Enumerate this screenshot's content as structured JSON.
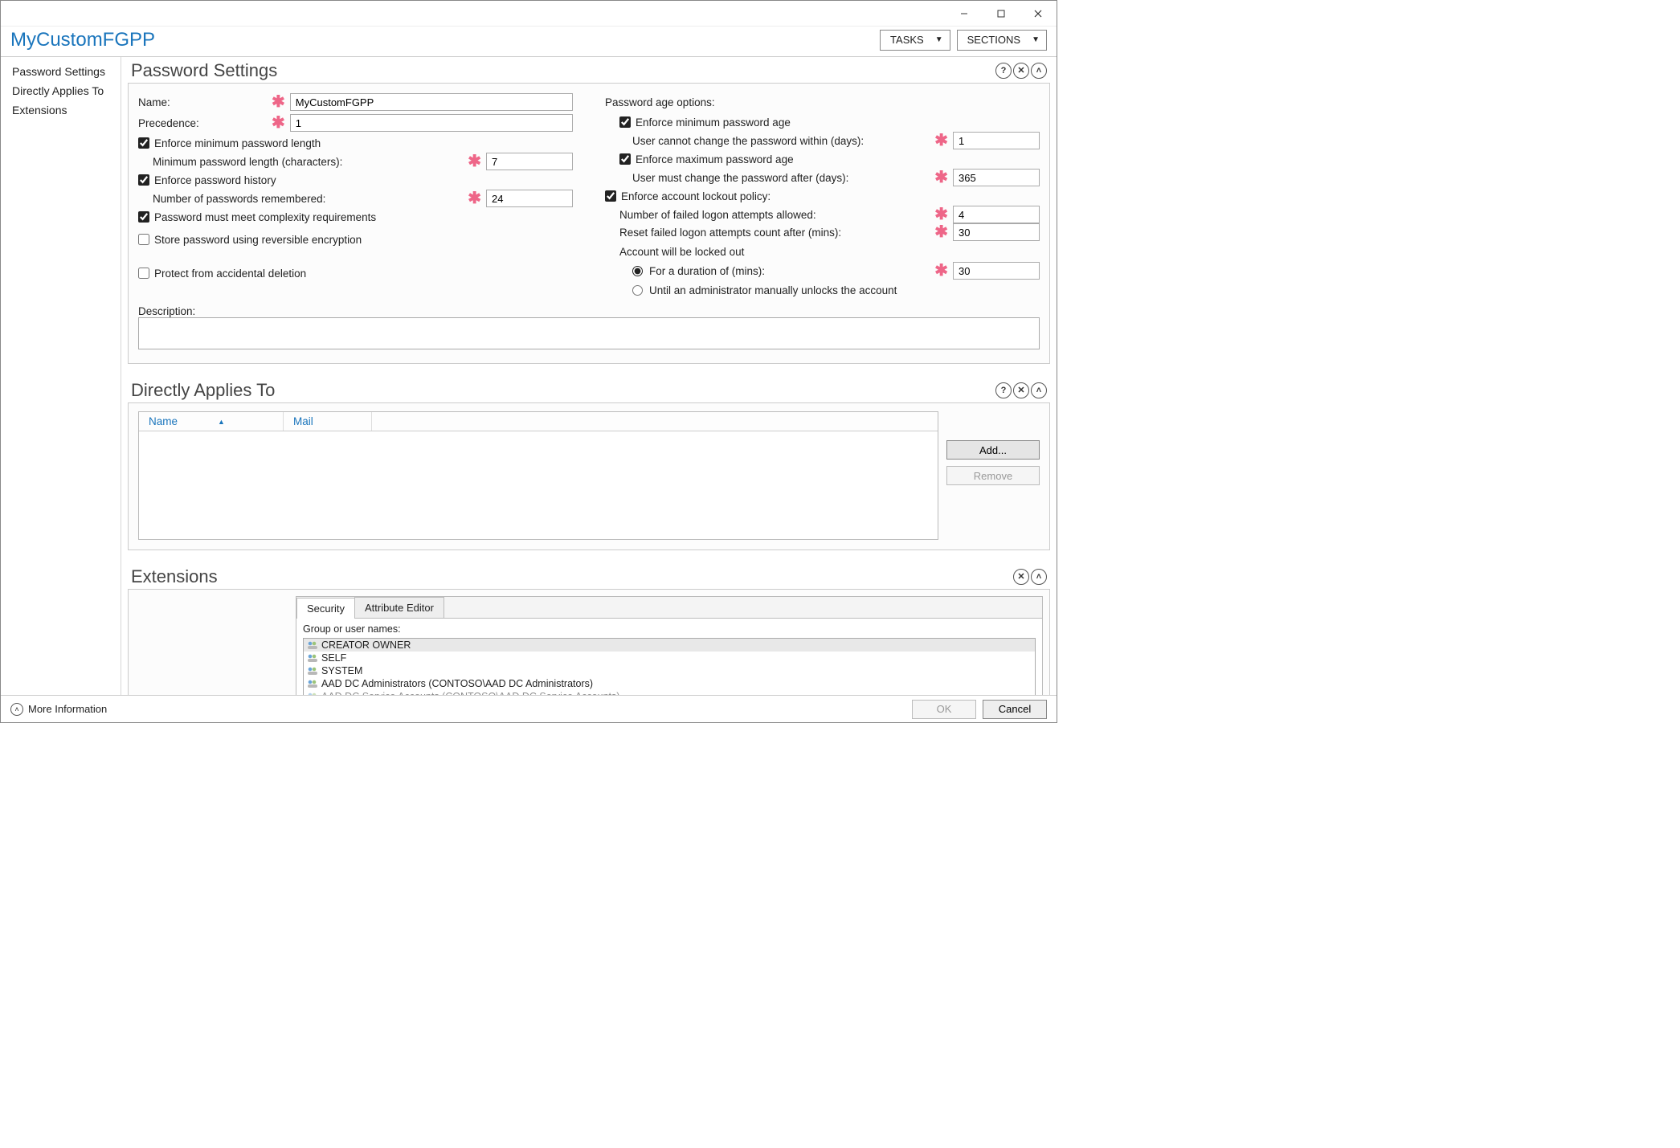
{
  "header": {
    "title": "MyCustomFGPP",
    "tasks_btn": "TASKS",
    "sections_btn": "SECTIONS"
  },
  "sidebar": {
    "items": [
      "Password Settings",
      "Directly Applies To",
      "Extensions"
    ]
  },
  "password_settings": {
    "section_title": "Password Settings",
    "name_label": "Name:",
    "name_value": "MyCustomFGPP",
    "precedence_label": "Precedence:",
    "precedence_value": "1",
    "enforce_min_len_label": "Enforce minimum password length",
    "min_len_label": "Minimum password length (characters):",
    "min_len_value": "7",
    "enforce_history_label": "Enforce password history",
    "history_label": "Number of passwords remembered:",
    "history_value": "24",
    "complexity_label": "Password must meet complexity requirements",
    "reversible_label": "Store password using reversible encryption",
    "protect_label": "Protect from accidental deletion",
    "description_label": "Description:",
    "description_value": "",
    "age_options_label": "Password age options:",
    "enforce_min_age_label": "Enforce minimum password age",
    "min_age_label": "User cannot change the password within (days):",
    "min_age_value": "1",
    "enforce_max_age_label": "Enforce maximum password age",
    "max_age_label": "User must change the password after (days):",
    "max_age_value": "365",
    "lockout_label": "Enforce account lockout policy:",
    "failed_attempts_label": "Number of failed logon attempts allowed:",
    "failed_attempts_value": "4",
    "reset_count_label": "Reset failed logon attempts count after (mins):",
    "reset_count_value": "30",
    "lockout_header": "Account will be locked out",
    "lockout_duration_label": "For a duration of (mins):",
    "lockout_duration_value": "30",
    "lockout_admin_label": "Until an administrator manually unlocks the account"
  },
  "directly_applies": {
    "section_title": "Directly Applies To",
    "col_name": "Name",
    "col_mail": "Mail",
    "add_btn": "Add...",
    "remove_btn": "Remove"
  },
  "extensions": {
    "section_title": "Extensions",
    "tabs": {
      "security": "Security",
      "attr": "Attribute Editor"
    },
    "group_label": "Group or user names:",
    "list": [
      "CREATOR OWNER",
      "SELF",
      "SYSTEM",
      "AAD DC Administrators (CONTOSO\\AAD DC Administrators)",
      "AAD DC Service Accounts (CONTOSO\\AAD DC Service Accounts)"
    ]
  },
  "footer": {
    "more_info": "More Information",
    "ok": "OK",
    "cancel": "Cancel"
  }
}
